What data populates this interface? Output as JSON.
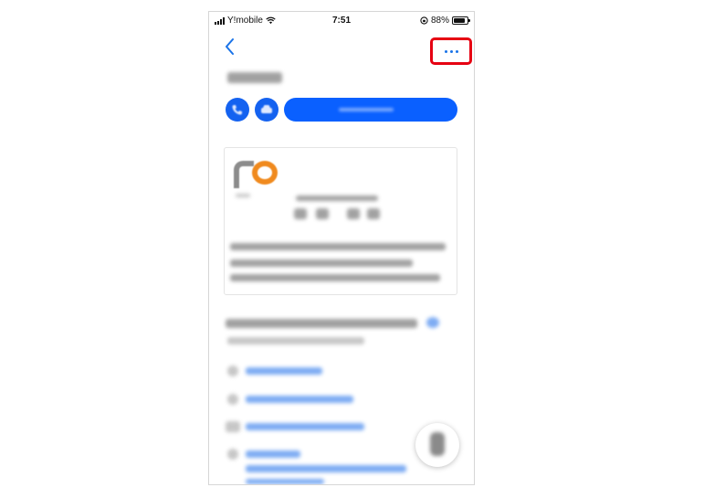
{
  "status_bar": {
    "carrier": "Y!mobile",
    "time": "7:51",
    "battery_percent": "88%",
    "battery_level": 0.88
  },
  "nav": {
    "back_icon": "chevron-left-icon",
    "more_icon": "ellipsis-icon",
    "highlight_color": "#e60012",
    "accent_color": "#1a73e8"
  },
  "actions": {
    "call_icon": "phone-icon",
    "route_icon": "car-icon"
  },
  "floating_button": {
    "icon": "person-icon"
  }
}
